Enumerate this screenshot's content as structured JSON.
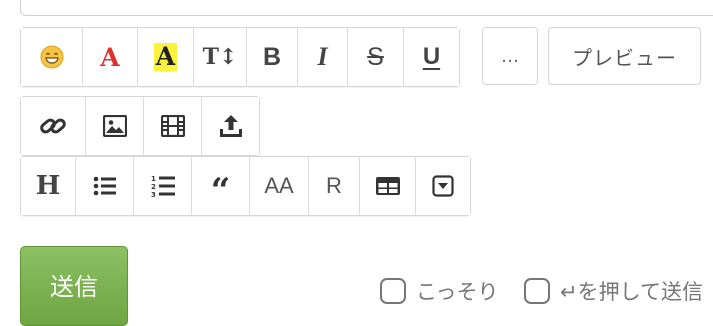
{
  "toolbar_row1": {
    "font_color_label": "A",
    "highlight_label": "A",
    "font_size_label": "T↕",
    "bold_label": "B",
    "italic_label": "I",
    "strike_label": "S",
    "underline_label": "U"
  },
  "more_label": "…",
  "preview_label": "プレビュー",
  "toolbar_row3": {
    "heading_label": "H",
    "quote_label": "“",
    "aa_label": "AA",
    "ruby_label": "R"
  },
  "submit_label": "送信",
  "options": {
    "secret_label": "こっそり",
    "enter_send_label": "↵を押して送信"
  },
  "colors": {
    "font_color": "#e0322b",
    "highlight": "#fbf33b",
    "submit_green": "#7bb04e",
    "border": "#d6d6d6"
  }
}
